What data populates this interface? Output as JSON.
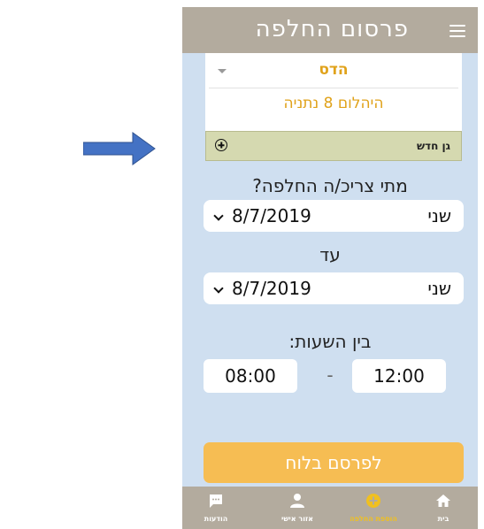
{
  "header": {
    "title": "פרסום החלפה",
    "menu_icon": "hamburger-icon"
  },
  "kindergarten": {
    "selected": "הדס",
    "address": "היהלום 8 נתניה",
    "new_label": "גן חדש"
  },
  "when": {
    "question": "מתי צריכ/ה החלפה?",
    "from": {
      "day": "שני",
      "date": "8/7/2019"
    },
    "to_label": "עד",
    "to": {
      "day": "שני",
      "date": "8/7/2019"
    }
  },
  "hours": {
    "label": "בין השעות:",
    "start": "08:00",
    "separator": "-",
    "end": "12:00"
  },
  "publish_label": "לפרסם בלוח",
  "tabs": [
    {
      "label": "בית",
      "icon": "home-icon"
    },
    {
      "label": "הוספת החלפה",
      "icon": "add-circle-icon"
    },
    {
      "label": "אזור אישי",
      "icon": "person-icon"
    },
    {
      "label": "הודעות",
      "icon": "message-icon"
    }
  ],
  "colors": {
    "header": "#b3ab9e",
    "background": "#cfdff0",
    "accent": "#e0a21a",
    "publish_button": "#f6bd53",
    "new_gan": "#d5d9b0",
    "arrow": "#4472c4"
  }
}
